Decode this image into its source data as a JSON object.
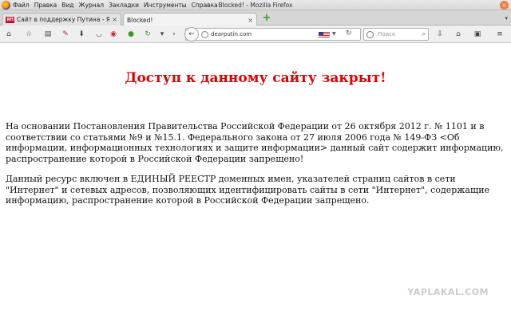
{
  "window": {
    "title": "Blocked! - Mozilla Firefox"
  },
  "menu": {
    "items": [
      "Файл",
      "Правка",
      "Вид",
      "Журнал",
      "Закладки",
      "Инструменты",
      "Справка"
    ]
  },
  "tabs": [
    {
      "label": "Сайт в поддержку Путина - ЯПл...",
      "favicon": "ЯП",
      "active": false
    },
    {
      "label": "Blocked!",
      "active": true
    }
  ],
  "urlbar": {
    "value": "dearputin.com"
  },
  "search": {
    "placeholder": "Поиск"
  },
  "page": {
    "heading": "Доступ к данному сайту закрыт!",
    "para1": "На основании Постановления Правительства Российской Федерации от 26 октября 2012 г. № 1101 и в соответствии со статьями №9 и №15.1. Федерального закона от 27 июля 2006 года № 149-ФЗ <Об информации, информационных технологиях и защите информации> данный сайт содержит информацию, распространение которой в Российской Федерации запрещено!",
    "para2": "Данный ресурс включен в ЕДИНЫЙ РЕЕСТР доменных имен, указателей страниц сайтов в сети \"Интернет\" и сетевых адресов, позволяющих идентифицировать сайты в сети \"Интернет\", содержащие информацию, распространение которой в Российской Федерации запрещено."
  },
  "watermark": "YAPLAKAL.COM",
  "colors": {
    "heading": "#e00000",
    "new_tab": "#3a9b1c",
    "close_button": "#ef7b3f"
  }
}
